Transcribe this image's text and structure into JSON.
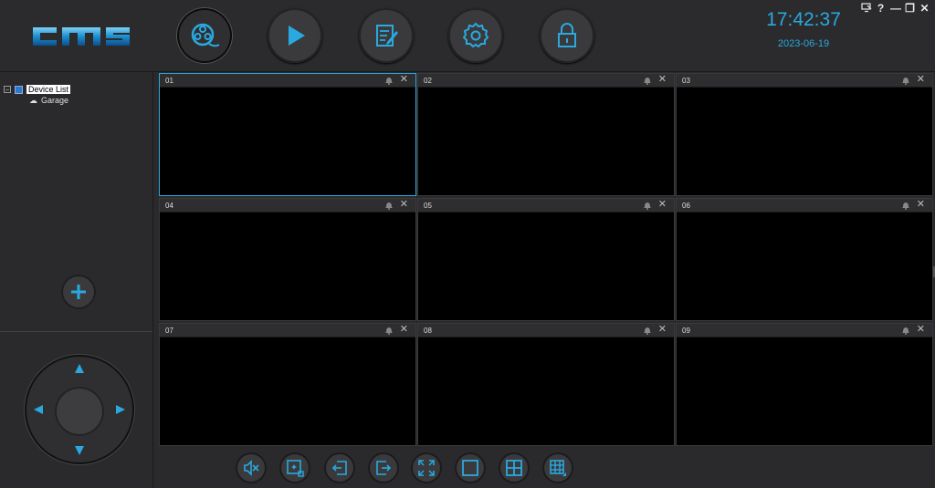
{
  "header": {
    "logo_text": "CMS",
    "time": "17:42:37",
    "date": "2023-06-19",
    "nav": [
      {
        "name": "live-view-button",
        "icon": "film-reel-icon",
        "active": true
      },
      {
        "name": "playback-button",
        "icon": "play-icon",
        "active": false
      },
      {
        "name": "log-button",
        "icon": "edit-document-icon",
        "active": false
      },
      {
        "name": "settings-button",
        "icon": "gear-icon",
        "active": false
      },
      {
        "name": "lock-button",
        "icon": "lock-icon",
        "active": false
      }
    ],
    "window_controls": {
      "connect": "monitor-link-icon",
      "help": "?",
      "minimize": "—",
      "restore": "❐",
      "close": "✕"
    }
  },
  "sidebar": {
    "tree": {
      "expander": "−",
      "root_label": "Device List",
      "children": [
        {
          "label": "Garage",
          "icon": "cloud-icon"
        }
      ]
    },
    "add_button": "plus-icon",
    "ptz": [
      "up-arrow-icon",
      "down-arrow-icon",
      "left-arrow-icon",
      "right-arrow-icon"
    ]
  },
  "grid": {
    "cells": [
      {
        "label": "01",
        "selected": true
      },
      {
        "label": "02",
        "selected": false
      },
      {
        "label": "03",
        "selected": false
      },
      {
        "label": "04",
        "selected": false
      },
      {
        "label": "05",
        "selected": false
      },
      {
        "label": "06",
        "selected": false
      },
      {
        "label": "07",
        "selected": false
      },
      {
        "label": "08",
        "selected": false
      },
      {
        "label": "09",
        "selected": false
      }
    ],
    "cell_close": "✕"
  },
  "toolbar": [
    "mute-icon",
    "capture-icon",
    "exit-full-icon",
    "enter-icon",
    "fullscreen-icon",
    "layout-1-icon",
    "layout-4-icon",
    "layout-custom-icon"
  ],
  "colors": {
    "accent": "#29a9e0",
    "background": "#2a2a2c",
    "video": "#000000"
  }
}
